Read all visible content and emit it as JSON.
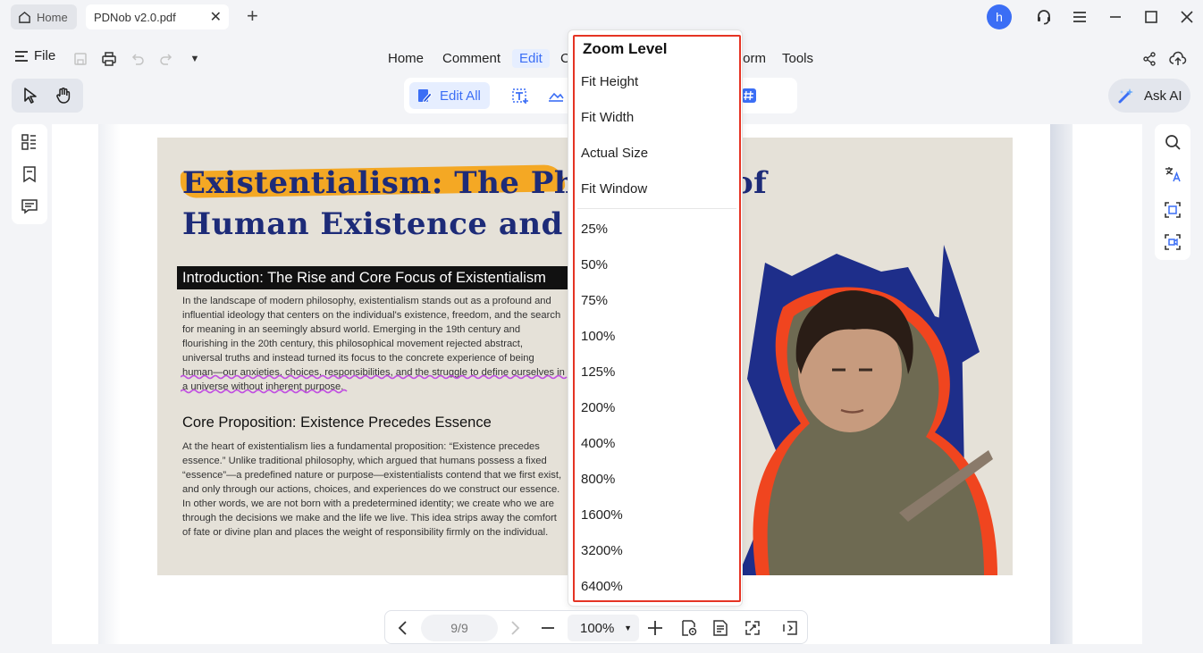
{
  "tabs": {
    "home_label": "Home",
    "doc_label": "PDNob v2.0.pdf",
    "avatar_initial": "h"
  },
  "menubar": {
    "file_label": "File",
    "items": [
      "Home",
      "Comment",
      "Edit",
      "C",
      "Form",
      "Tools"
    ],
    "active": "Edit"
  },
  "edit_toolbar": {
    "edit_all_label": "Edit All"
  },
  "ask_ai_label": "Ask AI",
  "document": {
    "title_line1": "Existentialism: The Philosophy of",
    "title_line2": "Human Existence and Freedom",
    "intro_heading": "Introduction: The Rise and Core Focus of Existentialism",
    "intro_text": "In the landscape of modern philosophy, existentialism stands out as a profound and\ninfluential ideology that centers on the individual's existence, freedom, and the search\nfor meaning in an seemingly absurd world. Emerging in the 19th century and\nflourishing in the 20th century, this philosophical movement rejected abstract,\nuniversal truths and instead turned its focus to the concrete experience of being\nhuman—our anxieties, choices, responsibilities, and the struggle to define ourselves in\na universe without inherent purpose.",
    "section_heading": "Core Proposition: Existence Precedes Essence",
    "section_text": " At the heart of existentialism lies a fundamental proposition: “Existence precedes\nessence.” Unlike traditional philosophy, which argued that humans possess a fixed\n“essence”—a predefined nature or purpose—existentialists contend that we first exist,\nand only through our actions, choices, and experiences do we construct our essence.\nIn other words, we are not born with a predetermined identity; we create who we are\nthrough the decisions we make and the life we live. This idea strips away the comfort\nof fate or divine plan and places the weight of responsibility firmly on the individual."
  },
  "zoom_menu": {
    "title": "Zoom Level",
    "fit_options": [
      "Fit Height",
      "Fit Width",
      "Actual Size",
      "Fit Window"
    ],
    "levels": [
      "25%",
      "50%",
      "75%",
      "100%",
      "125%",
      "200%",
      "400%",
      "800%",
      "1600%",
      "3200%",
      "6400%"
    ]
  },
  "bottom_bar": {
    "page_indicator": "9/9",
    "zoom_value": "100%"
  },
  "colors": {
    "accent": "#3b6ef5",
    "highlight_outline": "#e53424",
    "title_navy": "#1d2b78",
    "brush_orange": "#f4a41a"
  }
}
